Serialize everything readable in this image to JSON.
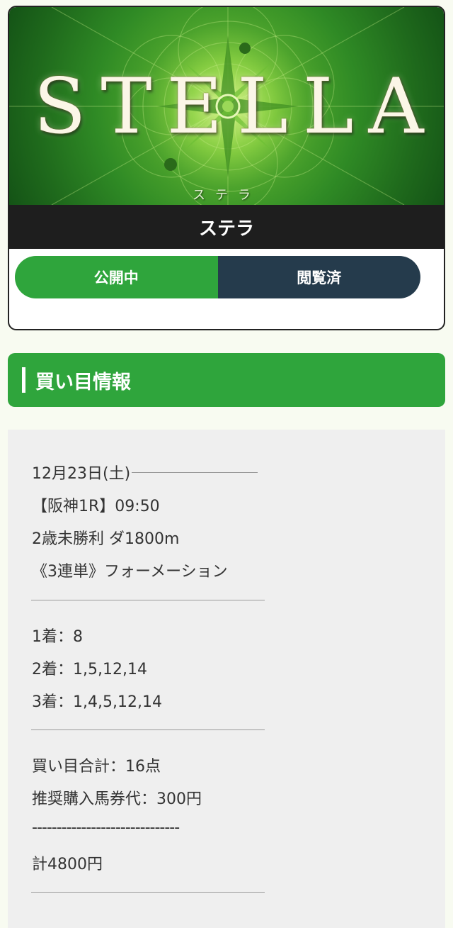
{
  "banner": {
    "title_letters": [
      "S",
      "T",
      "E",
      "L",
      "L",
      "A"
    ],
    "subtitle": "ステラ"
  },
  "site_name": "ステラ",
  "status": {
    "public_label": "公開中",
    "viewed_label": "閲覧済"
  },
  "section": {
    "title": "買い目情報"
  },
  "race": {
    "date": "12月23日(土)",
    "venue_time": "【阪神1R】09:50",
    "condition": "2歳未勝利 ダ1800m",
    "bet_type": "《3連単》フォーメーション"
  },
  "picks": {
    "first": "1着：8",
    "second": "2着：1,5,12,14",
    "third": "3着：1,4,5,12,14"
  },
  "summary": {
    "total_points": "買い目合計：16点",
    "unit_price": "推奨購入馬券代：300円",
    "separator": "------------------------------",
    "total": "計4800円"
  },
  "colors": {
    "accent_green": "#2fa53c",
    "viewed_navy": "#253b4c",
    "name_bar": "#1e1e1e"
  }
}
